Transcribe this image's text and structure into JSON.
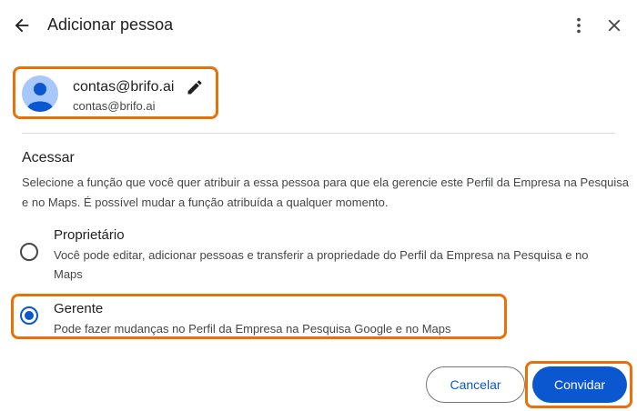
{
  "dialog": {
    "title": "Adicionar pessoa"
  },
  "icons": {
    "back": "arrow-back-icon",
    "more": "more-vert-icon",
    "close": "close-icon",
    "edit": "pencil-icon",
    "avatar": "person-avatar-icon"
  },
  "account": {
    "name": "contas@brifo.ai",
    "email": "contas@brifo.ai"
  },
  "access": {
    "title": "Acessar",
    "description": "Selecione a função que você quer atribuir a essa pessoa para que ela gerencie este Perfil da Empresa na Pesquisa e no Maps. É possível mudar a função atribuída a qualquer momento."
  },
  "roles": [
    {
      "label": "Proprietário",
      "description": "Você pode editar, adicionar pessoas e transferir a propriedade do Perfil da Empresa na Pesquisa e no Maps",
      "selected": false
    },
    {
      "label": "Gerente",
      "description": "Pode fazer mudanças no Perfil da Empresa na Pesquisa Google e no Maps",
      "selected": true
    }
  ],
  "actions": {
    "cancel_label": "Cancelar",
    "invite_label": "Convidar"
  },
  "colors": {
    "accent": "#0b57d0",
    "highlight": "#e8710a",
    "avatar_bg": "#a8c7fa",
    "avatar_fg": "#0b57d0"
  }
}
